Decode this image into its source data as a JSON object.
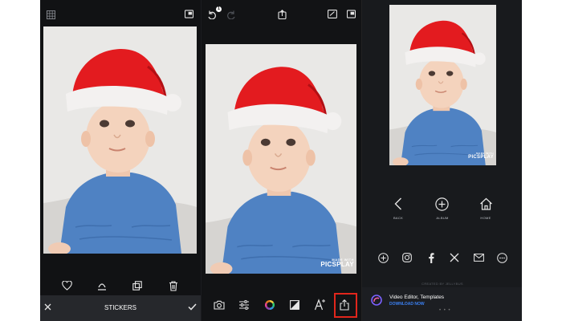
{
  "colors": {
    "panel_bg": "#111214",
    "accent_share_highlight": "#e1261c",
    "download_link": "#3b82f6"
  },
  "watermark": {
    "made_with": "MADE WITH",
    "brand": "PICSPLAY"
  },
  "screen1": {
    "top_icons": [
      "grid-icon",
      "picture-in-picture-icon"
    ],
    "actions": [
      "heart-icon",
      "flip-icon",
      "layer-copy-icon",
      "trash-icon"
    ],
    "bottom_bar": {
      "close": "close-icon",
      "title": "STICKERS",
      "confirm": "check-icon"
    }
  },
  "screen2": {
    "top_icons": [
      "undo-icon",
      "redo-icon",
      "share-top-icon",
      "edit-icon",
      "picture-in-picture-icon"
    ],
    "undo_badge": "1",
    "toolbar": [
      "camera-icon",
      "adjust-sliders-icon",
      "color-wheel-icon",
      "contrast-icon",
      "text-icon",
      "share-icon"
    ]
  },
  "screen3": {
    "nav": {
      "back": "BACK",
      "album": "ALBUM",
      "home": "HOME"
    },
    "share_targets": [
      "more-share-icon",
      "instagram-icon",
      "facebook-icon",
      "x-icon",
      "mail-icon",
      "ellipsis-icon"
    ],
    "created_by": "CREATED BY JELLYBUS",
    "ad": {
      "title": "Video Editor, Templates",
      "link": "DOWNLOAD NOW"
    }
  }
}
